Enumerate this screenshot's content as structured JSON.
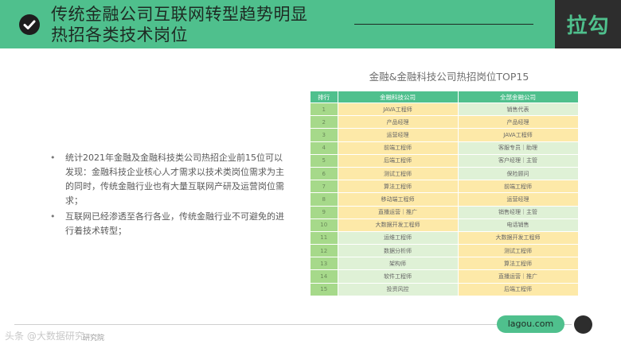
{
  "header": {
    "title_line1": "传统金融公司互联网转型趋势明显",
    "title_line2": "热招各类技术岗位",
    "check_icon": "check-circle-icon",
    "brand": "拉勾",
    "colors": {
      "accent": "#4fc08d",
      "dark": "#2d2d2d"
    }
  },
  "bullets": [
    "统计2021年金融及金融科技类公司热招企业前15位可以发现：金融科技企业核心人才需求以技术类岗位需求为主的同时，传统金融行业也有大量互联网产研及运营岗位需求；",
    "互联网已经渗透至各行各业，传统金融行业不可避免的进行着技术转型；"
  ],
  "table": {
    "title": "金融&金融科技公司热招岗位TOP15",
    "headers": [
      "排行",
      "金融科技公司",
      "全部金融公司"
    ],
    "rows": [
      [
        "1",
        "JAVA工程师",
        "销售代表"
      ],
      [
        "2",
        "产品经理",
        "产品经理"
      ],
      [
        "3",
        "运营经理",
        "JAVA工程师"
      ],
      [
        "4",
        "前端工程师",
        "客服专员｜助理"
      ],
      [
        "5",
        "后端工程师",
        "客户经理｜主管"
      ],
      [
        "6",
        "测试工程师",
        "保险顾问"
      ],
      [
        "7",
        "算法工程师",
        "前端工程师"
      ],
      [
        "8",
        "移动端工程师",
        "运营经理"
      ],
      [
        "9",
        "直播运营｜推广",
        "销售经理｜主管"
      ],
      [
        "10",
        "大数据开发工程师",
        "电话销售"
      ],
      [
        "11",
        "运维工程师",
        "大数据开发工程师"
      ],
      [
        "12",
        "数据分析师",
        "测试工程师"
      ],
      [
        "13",
        "架构师",
        "算法工程师"
      ],
      [
        "14",
        "软件工程师",
        "直播运营｜推广"
      ],
      [
        "15",
        "投资风控",
        "后端工程师"
      ]
    ],
    "cell_colors": [
      [
        "y",
        "g"
      ],
      [
        "y",
        "y"
      ],
      [
        "y",
        "y"
      ],
      [
        "y",
        "g"
      ],
      [
        "y",
        "g"
      ],
      [
        "y",
        "g"
      ],
      [
        "y",
        "y"
      ],
      [
        "y",
        "y"
      ],
      [
        "y",
        "g"
      ],
      [
        "y",
        "g"
      ],
      [
        "g",
        "y"
      ],
      [
        "g",
        "y"
      ],
      [
        "g",
        "y"
      ],
      [
        "g",
        "y"
      ],
      [
        "g",
        "y"
      ]
    ]
  },
  "footer": {
    "url": "lagou.com",
    "watermark": "头条 @大数据研究",
    "credit": "研究院"
  }
}
